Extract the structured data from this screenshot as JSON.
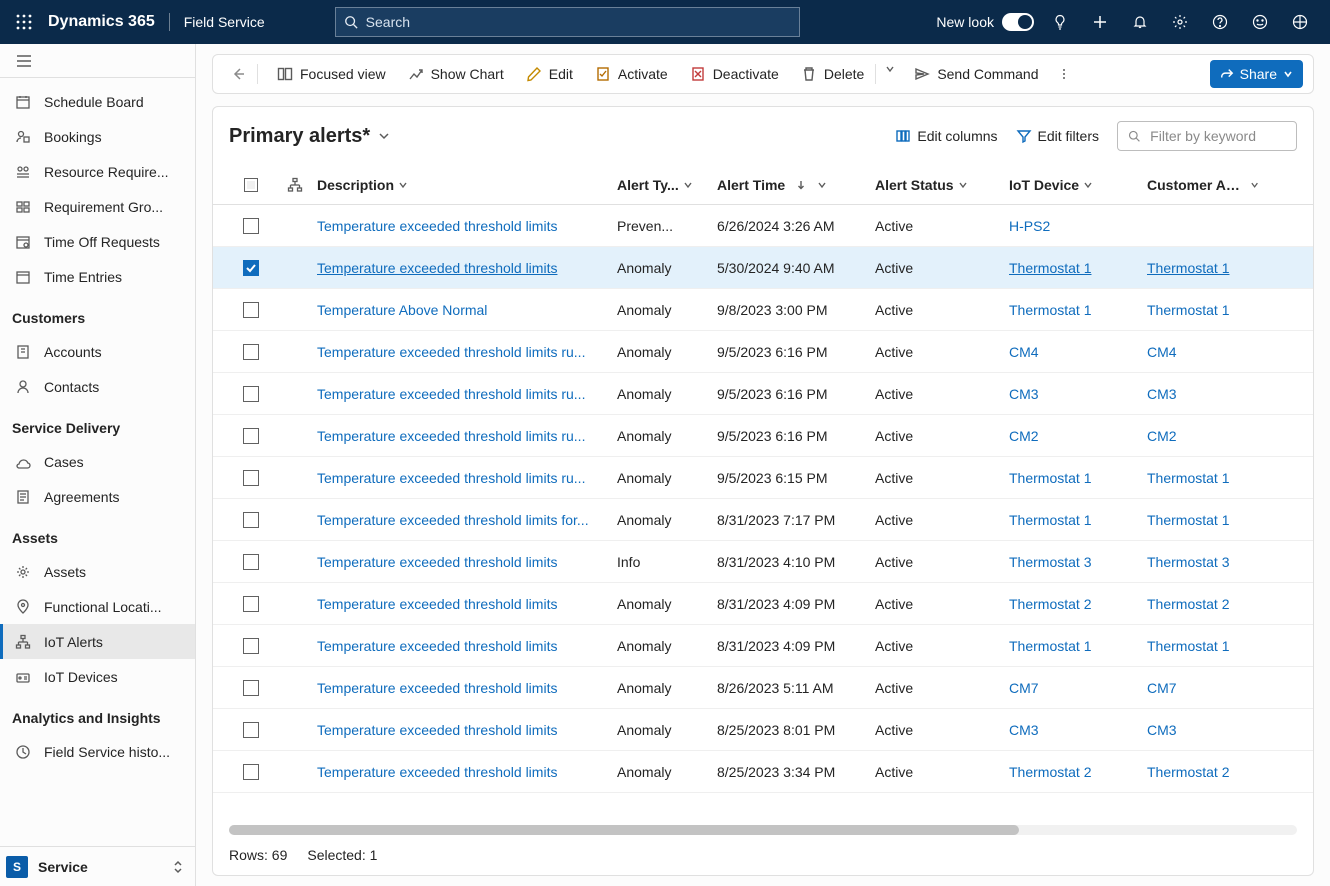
{
  "header": {
    "brand": "Dynamics 365",
    "app": "Field Service",
    "search_placeholder": "Search",
    "new_look": "New look"
  },
  "sidebar": {
    "items_top": [
      {
        "label": "Schedule Board"
      },
      {
        "label": "Bookings"
      },
      {
        "label": "Resource Require..."
      },
      {
        "label": "Requirement Gro..."
      },
      {
        "label": "Time Off Requests"
      },
      {
        "label": "Time Entries"
      }
    ],
    "section_customers": "Customers",
    "items_customers": [
      {
        "label": "Accounts"
      },
      {
        "label": "Contacts"
      }
    ],
    "section_service": "Service Delivery",
    "items_service": [
      {
        "label": "Cases"
      },
      {
        "label": "Agreements"
      }
    ],
    "section_assets": "Assets",
    "items_assets": [
      {
        "label": "Assets"
      },
      {
        "label": "Functional Locati..."
      },
      {
        "label": "IoT Alerts",
        "selected": true
      },
      {
        "label": "IoT Devices"
      }
    ],
    "section_analytics": "Analytics and Insights",
    "items_analytics": [
      {
        "label": "Field Service histo..."
      }
    ],
    "area_letter": "S",
    "area_label": "Service"
  },
  "commandbar": {
    "focused_view": "Focused view",
    "show_chart": "Show Chart",
    "edit": "Edit",
    "activate": "Activate",
    "deactivate": "Deactivate",
    "delete": "Delete",
    "send_command": "Send Command",
    "share": "Share"
  },
  "view": {
    "title": "Primary alerts*",
    "edit_columns": "Edit columns",
    "edit_filters": "Edit filters",
    "filter_placeholder": "Filter by keyword"
  },
  "columns": {
    "description": "Description",
    "alert_type": "Alert Ty...",
    "alert_time": "Alert Time",
    "alert_status": "Alert Status",
    "iot_device": "IoT Device",
    "customer_asset": "Customer Asset"
  },
  "rows": [
    {
      "desc": "Temperature exceeded threshold limits",
      "type": "Preven...",
      "time": "6/26/2024 3:26 AM",
      "status": "Active",
      "device": "H-PS2",
      "asset": ""
    },
    {
      "desc": "Temperature exceeded threshold limits",
      "type": "Anomaly",
      "time": "5/30/2024 9:40 AM",
      "status": "Active",
      "device": "Thermostat 1",
      "asset": "Thermostat 1",
      "selected": true
    },
    {
      "desc": "Temperature Above Normal",
      "type": "Anomaly",
      "time": "9/8/2023 3:00 PM",
      "status": "Active",
      "device": "Thermostat 1",
      "asset": "Thermostat 1"
    },
    {
      "desc": "Temperature exceeded threshold limits ru...",
      "type": "Anomaly",
      "time": "9/5/2023 6:16 PM",
      "status": "Active",
      "device": "CM4",
      "asset": "CM4"
    },
    {
      "desc": "Temperature exceeded threshold limits ru...",
      "type": "Anomaly",
      "time": "9/5/2023 6:16 PM",
      "status": "Active",
      "device": "CM3",
      "asset": "CM3"
    },
    {
      "desc": "Temperature exceeded threshold limits ru...",
      "type": "Anomaly",
      "time": "9/5/2023 6:16 PM",
      "status": "Active",
      "device": "CM2",
      "asset": "CM2"
    },
    {
      "desc": "Temperature exceeded threshold limits ru...",
      "type": "Anomaly",
      "time": "9/5/2023 6:15 PM",
      "status": "Active",
      "device": "Thermostat 1",
      "asset": "Thermostat 1"
    },
    {
      "desc": "Temperature exceeded threshold limits for...",
      "type": "Anomaly",
      "time": "8/31/2023 7:17 PM",
      "status": "Active",
      "device": "Thermostat 1",
      "asset": "Thermostat 1"
    },
    {
      "desc": "Temperature exceeded threshold limits",
      "type": "Info",
      "time": "8/31/2023 4:10 PM",
      "status": "Active",
      "device": "Thermostat 3",
      "asset": "Thermostat 3"
    },
    {
      "desc": "Temperature exceeded threshold limits",
      "type": "Anomaly",
      "time": "8/31/2023 4:09 PM",
      "status": "Active",
      "device": "Thermostat 2",
      "asset": "Thermostat 2"
    },
    {
      "desc": "Temperature exceeded threshold limits",
      "type": "Anomaly",
      "time": "8/31/2023 4:09 PM",
      "status": "Active",
      "device": "Thermostat 1",
      "asset": "Thermostat 1"
    },
    {
      "desc": "Temperature exceeded threshold limits",
      "type": "Anomaly",
      "time": "8/26/2023 5:11 AM",
      "status": "Active",
      "device": "CM7",
      "asset": "CM7"
    },
    {
      "desc": "Temperature exceeded threshold limits",
      "type": "Anomaly",
      "time": "8/25/2023 8:01 PM",
      "status": "Active",
      "device": "CM3",
      "asset": "CM3"
    },
    {
      "desc": "Temperature exceeded threshold limits",
      "type": "Anomaly",
      "time": "8/25/2023 3:34 PM",
      "status": "Active",
      "device": "Thermostat 2",
      "asset": "Thermostat 2"
    }
  ],
  "footer": {
    "rows_label": "Rows: 69",
    "selected_label": "Selected: 1"
  }
}
